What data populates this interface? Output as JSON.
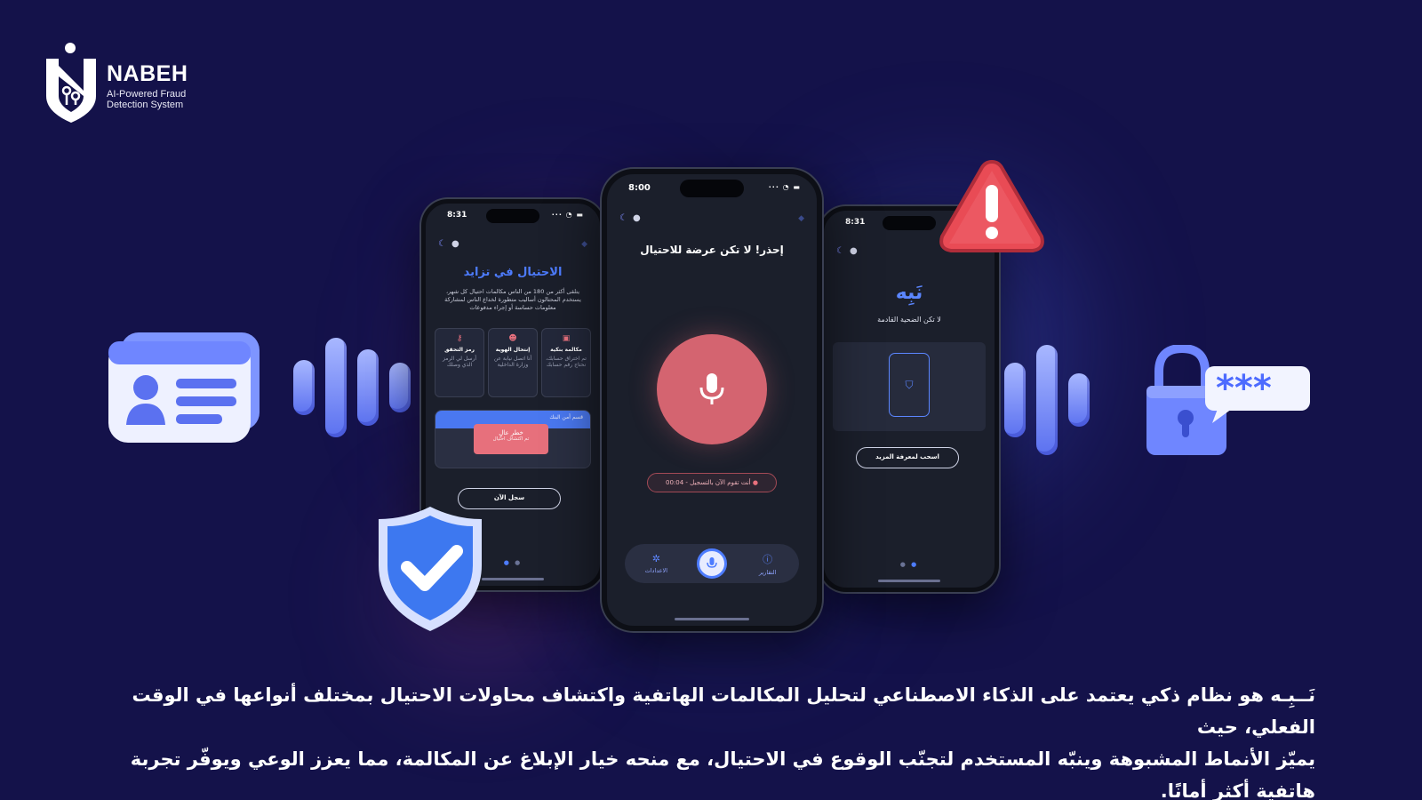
{
  "brand": {
    "name": "NABEH",
    "tagline_line1": "AI-Powered Fraud",
    "tagline_line2": "Detection System"
  },
  "phone_left": {
    "time": "8:31",
    "title": "الاحتيال في تزايد",
    "body": "يتلقى أكثر من 180 من الناس مكالمات احتيال كل شهر، يستخدم المحتالون أساليب متطورة لخداع الناس لمشاركة معلومات حساسة أو إجراء مدفوعات",
    "cards": [
      {
        "icon": "bank-icon",
        "title": "مكالمة بنكية",
        "text": "تم اختراق حسابك، نحتاج رقم حسابك"
      },
      {
        "icon": "person-icon",
        "title": "إنتحال الهوية",
        "text": "أنا اتصل نيابة عن وزارة الداخلية"
      },
      {
        "icon": "key-icon",
        "title": "رمز التحقق",
        "text": "أرسل لي الرمز الذي وصلك"
      }
    ],
    "banner": "قسم أمن البنك",
    "alert_title": "خطر عالٍ",
    "alert_sub": "تم اكتشاف احتيال",
    "button": "سجل الآن"
  },
  "phone_center": {
    "time": "8:00",
    "title": "إحذر! لا تكن عرضة للاحتيال",
    "recording": "أنت تقوم الآن بالتسجيل - 00:04",
    "tabs": [
      {
        "icon": "info-icon",
        "label": "التقارير"
      },
      {
        "icon": "mic-icon",
        "label": ""
      },
      {
        "icon": "gear-icon",
        "label": "الاعدادات"
      }
    ]
  },
  "phone_right": {
    "time": "8:31",
    "title": "نَبِه",
    "subtitle": "لا تكن الضحية القادمة",
    "button": "اسحب لمعرفة المزيد"
  },
  "caption": {
    "line1": "نَــبِـه هو نظام ذكي يعتمد على الذكاء الاصطناعي لتحليل المكالمات الهاتفية واكتشاف محاولات الاحتيال بمختلف أنواعها في الوقت الفعلي، حيث",
    "line2": "يميّز الأنماط المشبوهة وينبّه المستخدم لتجنّب الوقوع في الاحتيال، مع منحه خيار الإبلاغ عن المكالمة، مما يعزز الوعي ويوفّر تجربة هاتفية أكثر أمانًا."
  },
  "colors": {
    "background": "#14124a",
    "accent": "#4d7cff",
    "danger": "#d46470"
  }
}
